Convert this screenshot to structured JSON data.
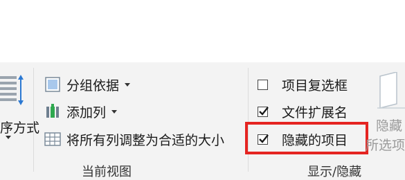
{
  "layout_group": {
    "sort_by_label": "序方式"
  },
  "current_view": {
    "group_by_label": "分组依据",
    "add_columns_label": "添加列",
    "size_all_columns_label": "将所有列调整为合适的大小",
    "group_label": "当前视图"
  },
  "show_hide": {
    "item_checkboxes": {
      "label": "项目复选框",
      "checked": false
    },
    "file_name_extensions": {
      "label": "文件扩展名",
      "checked": true
    },
    "hidden_items": {
      "label": "隐藏的项目",
      "checked": true
    },
    "hide_selected_line1": "隐藏",
    "hide_selected_line2": "所选项",
    "group_label": "显示/隐藏"
  },
  "colors": {
    "highlight_border": "#e52421",
    "ribbon_bg": "#f3f3f3",
    "accent_blue": "#2b78d2"
  }
}
